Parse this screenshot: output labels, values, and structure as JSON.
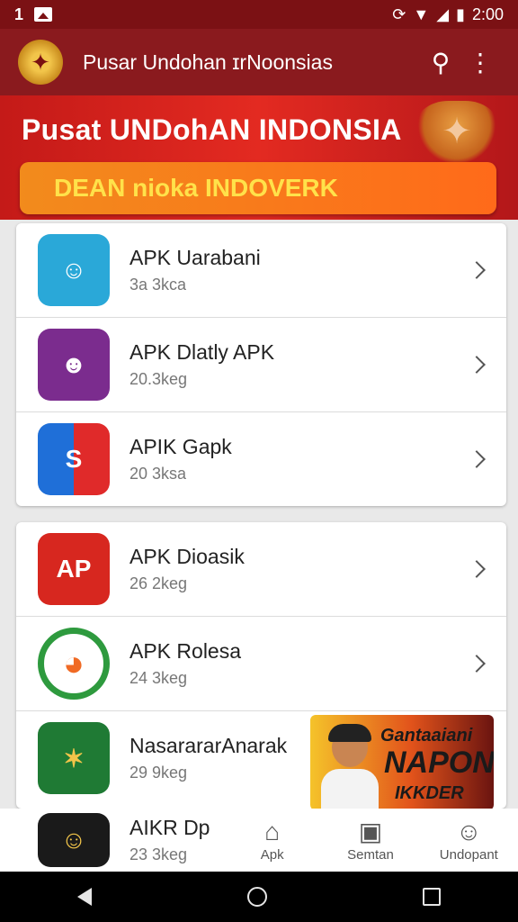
{
  "status_bar": {
    "left_text": "1",
    "time": "2:00",
    "icons": [
      "image-icon",
      "rotate-icon",
      "wifi-icon",
      "signal-icon",
      "battery-icon"
    ]
  },
  "app_bar": {
    "title": "Pusar Undohan ɪrNoonsias",
    "icons": [
      "garuda-logo",
      "search-icon",
      "more-vert-icon"
    ]
  },
  "banner": {
    "title": "Pusat UNDohAN INDONSIA",
    "button_label": "DEAN nioka INDOVERK"
  },
  "list_group_1": [
    {
      "name": "APK Uarabani",
      "size": "3a 3kca",
      "icon_color": "#2aa8d8",
      "icon_glyph": "☺"
    },
    {
      "name": "APK Dlatly APK",
      "size": "20.3keg",
      "icon_color": "#7b2c8e",
      "icon_glyph": "☻"
    },
    {
      "name": "APIK Gapk",
      "size": "20 3ksa",
      "icon_color": "#ffffff",
      "icon_glyph": "S"
    }
  ],
  "list_group_2": [
    {
      "name": "APK Dioasik",
      "size": "26 2keg",
      "icon_color": "#d7271f",
      "icon_glyph": "AP"
    },
    {
      "name": "APK Rolesa",
      "size": "24 3keg",
      "icon_color": "#ffffff",
      "icon_glyph": "◕"
    },
    {
      "name": "NasarararAnarak",
      "size": "29 9keg",
      "icon_color": "#1f7a34",
      "icon_glyph": "✶"
    }
  ],
  "ad": {
    "line1": "Gantaaiani",
    "line2": "NAPON",
    "line3": "IKKDER"
  },
  "partial_row": {
    "name": "AIKR Dp",
    "size": "23 3keg",
    "icon_color": "#1a1a1a",
    "icon_glyph": "☺"
  },
  "bottom_nav": [
    {
      "label": "Apk",
      "icon": "⌂"
    },
    {
      "label": "Semtan",
      "icon": "▣"
    },
    {
      "label": "Undopant",
      "icon": "☺"
    }
  ]
}
